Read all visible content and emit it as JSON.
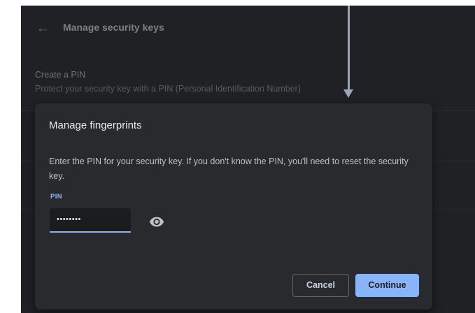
{
  "page": {
    "title": "Manage security keys",
    "back_icon": "arrow-back-icon"
  },
  "settings_row": {
    "title": "Create a PIN",
    "subtitle": "Protect your security key with a PIN (Personal Identification Number)"
  },
  "dialog": {
    "title": "Manage fingerprints",
    "message": "Enter the PIN for your security key. If you don't know the PIN, you'll need to reset the security key.",
    "pin_label": "PIN",
    "pin_value": "••••••••",
    "show_pin_icon": "eye-icon",
    "cancel_label": "Cancel",
    "continue_label": "Continue"
  },
  "colors": {
    "background": "#202124",
    "dialog": "#292a2d",
    "accent": "#8ab4f8"
  }
}
